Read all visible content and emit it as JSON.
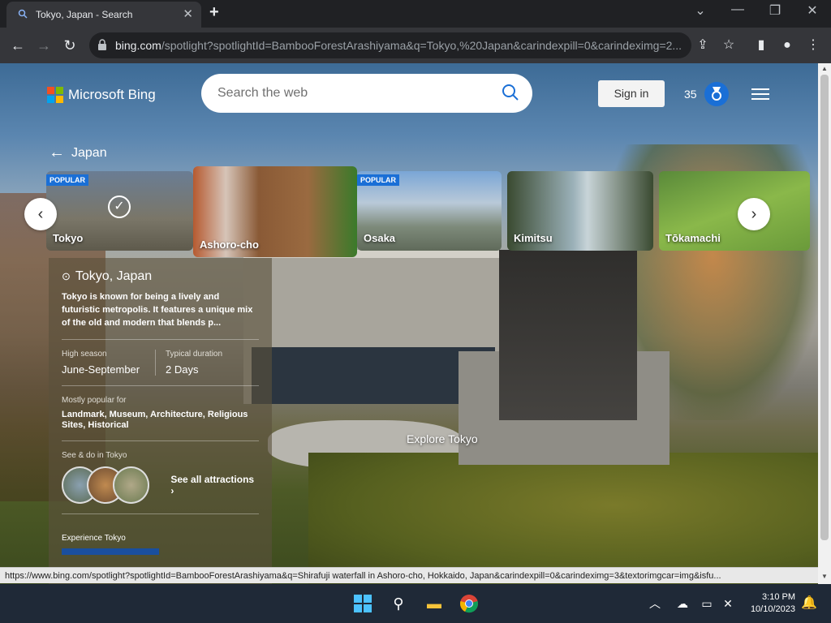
{
  "browser": {
    "tab_title": "Tokyo, Japan - Search",
    "new_tab": "+",
    "url_domain": "bing.com",
    "url_path": "/spotlight?spotlightId=BambooForestArashiyama&q=Tokyo,%20Japan&carindexpill=0&carindeximg=2..."
  },
  "header": {
    "logo_text": "Microsoft Bing",
    "search_placeholder": "Search the web",
    "sign_in": "Sign in",
    "points": "35"
  },
  "breadcrumb": {
    "label": "Japan"
  },
  "carousel": {
    "cards": [
      {
        "label": "Tokyo",
        "badge": "POPULAR",
        "selected": true
      },
      {
        "label": "Ashoro-cho",
        "badge": "",
        "selected": false
      },
      {
        "label": "Osaka",
        "badge": "POPULAR",
        "selected": false
      },
      {
        "label": "Kimitsu",
        "badge": "",
        "selected": false
      },
      {
        "label": "Tōkamachi",
        "badge": "",
        "selected": false
      }
    ]
  },
  "panel": {
    "location": "Tokyo, Japan",
    "description": "Tokyo is known for being a lively and futuristic metropolis. It features a unique mix of the old and modern that blends p...",
    "high_season_label": "High season",
    "high_season_value": "June-September",
    "duration_label": "Typical duration",
    "duration_value": "2 Days",
    "popular_label": "Mostly popular for",
    "popular_value": "Landmark, Museum, Architecture, Religious Sites, Historical",
    "see_do_label": "See & do in Tokyo",
    "see_all": "See all attractions",
    "experience_label": "Experience Tokyo"
  },
  "explore_label": "Explore Tokyo",
  "status_url": "https://www.bing.com/spotlight?spotlightId=BambooForestArashiyama&q=Shirafuji waterfall in Ashoro-cho, Hokkaido, Japan&carindexpill=0&carindeximg=3&textorimgcar=img&isfu...",
  "taskbar": {
    "time": "3:10 PM",
    "date": "10/10/2023"
  },
  "colors": {
    "accent": "#1a6fd6",
    "chrome_bg": "#202124",
    "toolbar_bg": "#35363a"
  }
}
